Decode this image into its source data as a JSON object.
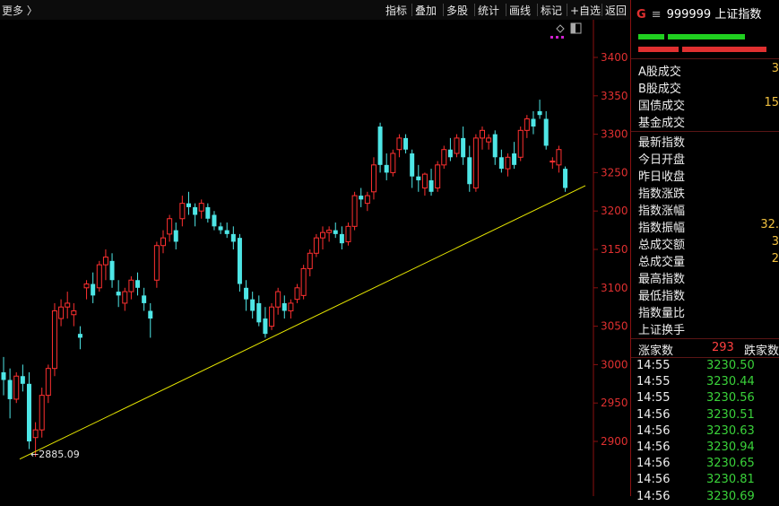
{
  "toolbar": {
    "more_label": "更多 〉",
    "buttons": [
      "指标",
      "叠加",
      "多股",
      "统计",
      "画线",
      "标记",
      "+自选",
      "返回"
    ]
  },
  "chart": {
    "type": "candlestick",
    "y_ticks": [
      "3400",
      "3350",
      "3300",
      "3250",
      "3200",
      "3150",
      "3100",
      "3050",
      "3000",
      "2950",
      "2900"
    ],
    "low_annotation": "←2885.09",
    "colors": {
      "up": "#ff3030",
      "down": "#4ee6e6",
      "trendline": "#e8e800",
      "tick": "#e03030"
    }
  },
  "chart_data": {
    "type": "candlestick",
    "ylim": [
      2870,
      3420
    ],
    "candles": [
      [
        2990,
        3010,
        2960,
        2980
      ],
      [
        2980,
        2995,
        2930,
        2955
      ],
      [
        2955,
        2990,
        2950,
        2985
      ],
      [
        2985,
        3000,
        2965,
        2975
      ],
      [
        2975,
        2990,
        2890,
        2900
      ],
      [
        2905,
        2925,
        2880,
        2915
      ],
      [
        2915,
        2970,
        2905,
        2960
      ],
      [
        2960,
        3000,
        2950,
        2995
      ],
      [
        2995,
        3080,
        2985,
        3070
      ],
      [
        3060,
        3085,
        3050,
        3075
      ],
      [
        3075,
        3095,
        3060,
        3080
      ],
      [
        3065,
        3080,
        3050,
        3070
      ],
      [
        3040,
        3050,
        3020,
        3035
      ],
      [
        3100,
        3110,
        3085,
        3105
      ],
      [
        3105,
        3120,
        3080,
        3090
      ],
      [
        3100,
        3135,
        3095,
        3130
      ],
      [
        3130,
        3150,
        3110,
        3140
      ],
      [
        3135,
        3145,
        3100,
        3110
      ],
      [
        3095,
        3110,
        3075,
        3090
      ],
      [
        3080,
        3100,
        3070,
        3095
      ],
      [
        3095,
        3115,
        3085,
        3110
      ],
      [
        3110,
        3120,
        3090,
        3100
      ],
      [
        3090,
        3100,
        3070,
        3080
      ],
      [
        3070,
        3080,
        3035,
        3060
      ],
      [
        3110,
        3160,
        3100,
        3155
      ],
      [
        3155,
        3175,
        3145,
        3165
      ],
      [
        3170,
        3195,
        3160,
        3190
      ],
      [
        3175,
        3185,
        3150,
        3160
      ],
      [
        3190,
        3220,
        3180,
        3210
      ],
      [
        3210,
        3225,
        3195,
        3205
      ],
      [
        3205,
        3210,
        3180,
        3195
      ],
      [
        3200,
        3215,
        3190,
        3210
      ],
      [
        3205,
        3210,
        3185,
        3190
      ],
      [
        3195,
        3200,
        3175,
        3180
      ],
      [
        3180,
        3185,
        3170,
        3175
      ],
      [
        3175,
        3185,
        3165,
        3170
      ],
      [
        3170,
        3180,
        3150,
        3160
      ],
      [
        3165,
        3170,
        3095,
        3105
      ],
      [
        3100,
        3110,
        3070,
        3085
      ],
      [
        3085,
        3095,
        3060,
        3070
      ],
      [
        3080,
        3090,
        3050,
        3055
      ],
      [
        3060,
        3075,
        3035,
        3040
      ],
      [
        3050,
        3080,
        3045,
        3075
      ],
      [
        3075,
        3100,
        3065,
        3095
      ],
      [
        3080,
        3090,
        3060,
        3070
      ],
      [
        3070,
        3085,
        3060,
        3080
      ],
      [
        3085,
        3105,
        3080,
        3100
      ],
      [
        3090,
        3130,
        3085,
        3125
      ],
      [
        3125,
        3150,
        3115,
        3145
      ],
      [
        3145,
        3170,
        3140,
        3165
      ],
      [
        3165,
        3180,
        3150,
        3172
      ],
      [
        3172,
        3180,
        3160,
        3175
      ],
      [
        3175,
        3185,
        3165,
        3170
      ],
      [
        3170,
        3180,
        3150,
        3158
      ],
      [
        3160,
        3185,
        3155,
        3180
      ],
      [
        3180,
        3225,
        3175,
        3220
      ],
      [
        3220,
        3230,
        3205,
        3215
      ],
      [
        3210,
        3225,
        3200,
        3220
      ],
      [
        3225,
        3270,
        3215,
        3260
      ],
      [
        3310,
        3315,
        3250,
        3260
      ],
      [
        3260,
        3275,
        3240,
        3250
      ],
      [
        3250,
        3280,
        3245,
        3275
      ],
      [
        3280,
        3300,
        3270,
        3295
      ],
      [
        3295,
        3300,
        3275,
        3280
      ],
      [
        3275,
        3280,
        3230,
        3245
      ],
      [
        3245,
        3260,
        3225,
        3240
      ],
      [
        3230,
        3250,
        3220,
        3248
      ],
      [
        3240,
        3255,
        3220,
        3225
      ],
      [
        3230,
        3265,
        3225,
        3260
      ],
      [
        3260,
        3285,
        3255,
        3280
      ],
      [
        3280,
        3295,
        3265,
        3270
      ],
      [
        3275,
        3300,
        3270,
        3295
      ],
      [
        3295,
        3310,
        3260,
        3270
      ],
      [
        3270,
        3285,
        3225,
        3235
      ],
      [
        3230,
        3300,
        3225,
        3295
      ],
      [
        3295,
        3310,
        3280,
        3305
      ],
      [
        3290,
        3300,
        3280,
        3295
      ],
      [
        3300,
        3305,
        3260,
        3270
      ],
      [
        3270,
        3280,
        3250,
        3255
      ],
      [
        3255,
        3275,
        3245,
        3270
      ],
      [
        3275,
        3290,
        3255,
        3260
      ],
      [
        3270,
        3310,
        3265,
        3305
      ],
      [
        3305,
        3325,
        3295,
        3320
      ],
      [
        3320,
        3330,
        3300,
        3310
      ],
      [
        3330,
        3345,
        3320,
        3325
      ],
      [
        3320,
        3330,
        3280,
        3285
      ],
      [
        3265,
        3270,
        3255,
        3265
      ],
      [
        3260,
        3285,
        3250,
        3280
      ],
      [
        3255,
        3258,
        3225,
        3230
      ]
    ],
    "trendline": {
      "from_price": 2877,
      "to_price": 3233
    }
  },
  "right_panel": {
    "code": "999999",
    "name": "上证指数",
    "g_label": "G",
    "menu_icon": "hamburger-icon",
    "turnover_rows": [
      {
        "label": "A股成交",
        "value": "3"
      },
      {
        "label": "B股成交",
        "value": ""
      },
      {
        "label": "国债成交",
        "value": "15"
      },
      {
        "label": "基金成交",
        "value": ""
      }
    ],
    "index_rows": [
      {
        "label": "最新指数",
        "value": ""
      },
      {
        "label": "今日开盘",
        "value": ""
      },
      {
        "label": "昨日收盘",
        "value": ""
      },
      {
        "label": "指数涨跌",
        "value": ""
      },
      {
        "label": "指数涨幅",
        "value": ""
      },
      {
        "label": "指数振幅",
        "value": "32."
      },
      {
        "label": "总成交额",
        "value": "3"
      },
      {
        "label": "总成交量",
        "value": "2"
      },
      {
        "label": "最高指数",
        "value": ""
      },
      {
        "label": "最低指数",
        "value": ""
      },
      {
        "label": "指数量比",
        "value": ""
      },
      {
        "label": "上证换手",
        "value": ""
      }
    ],
    "breadth": {
      "up_label": "涨家数",
      "up_value": "293",
      "down_label": "跌家数"
    },
    "ticks": [
      {
        "time": "14:55",
        "price": "3230.50"
      },
      {
        "time": "14:55",
        "price": "3230.44"
      },
      {
        "time": "14:55",
        "price": "3230.56"
      },
      {
        "time": "14:56",
        "price": "3230.51"
      },
      {
        "time": "14:56",
        "price": "3230.63"
      },
      {
        "time": "14:56",
        "price": "3230.94"
      },
      {
        "time": "14:56",
        "price": "3230.65"
      },
      {
        "time": "14:56",
        "price": "3230.81"
      },
      {
        "time": "14:56",
        "price": "3230.69"
      }
    ]
  }
}
